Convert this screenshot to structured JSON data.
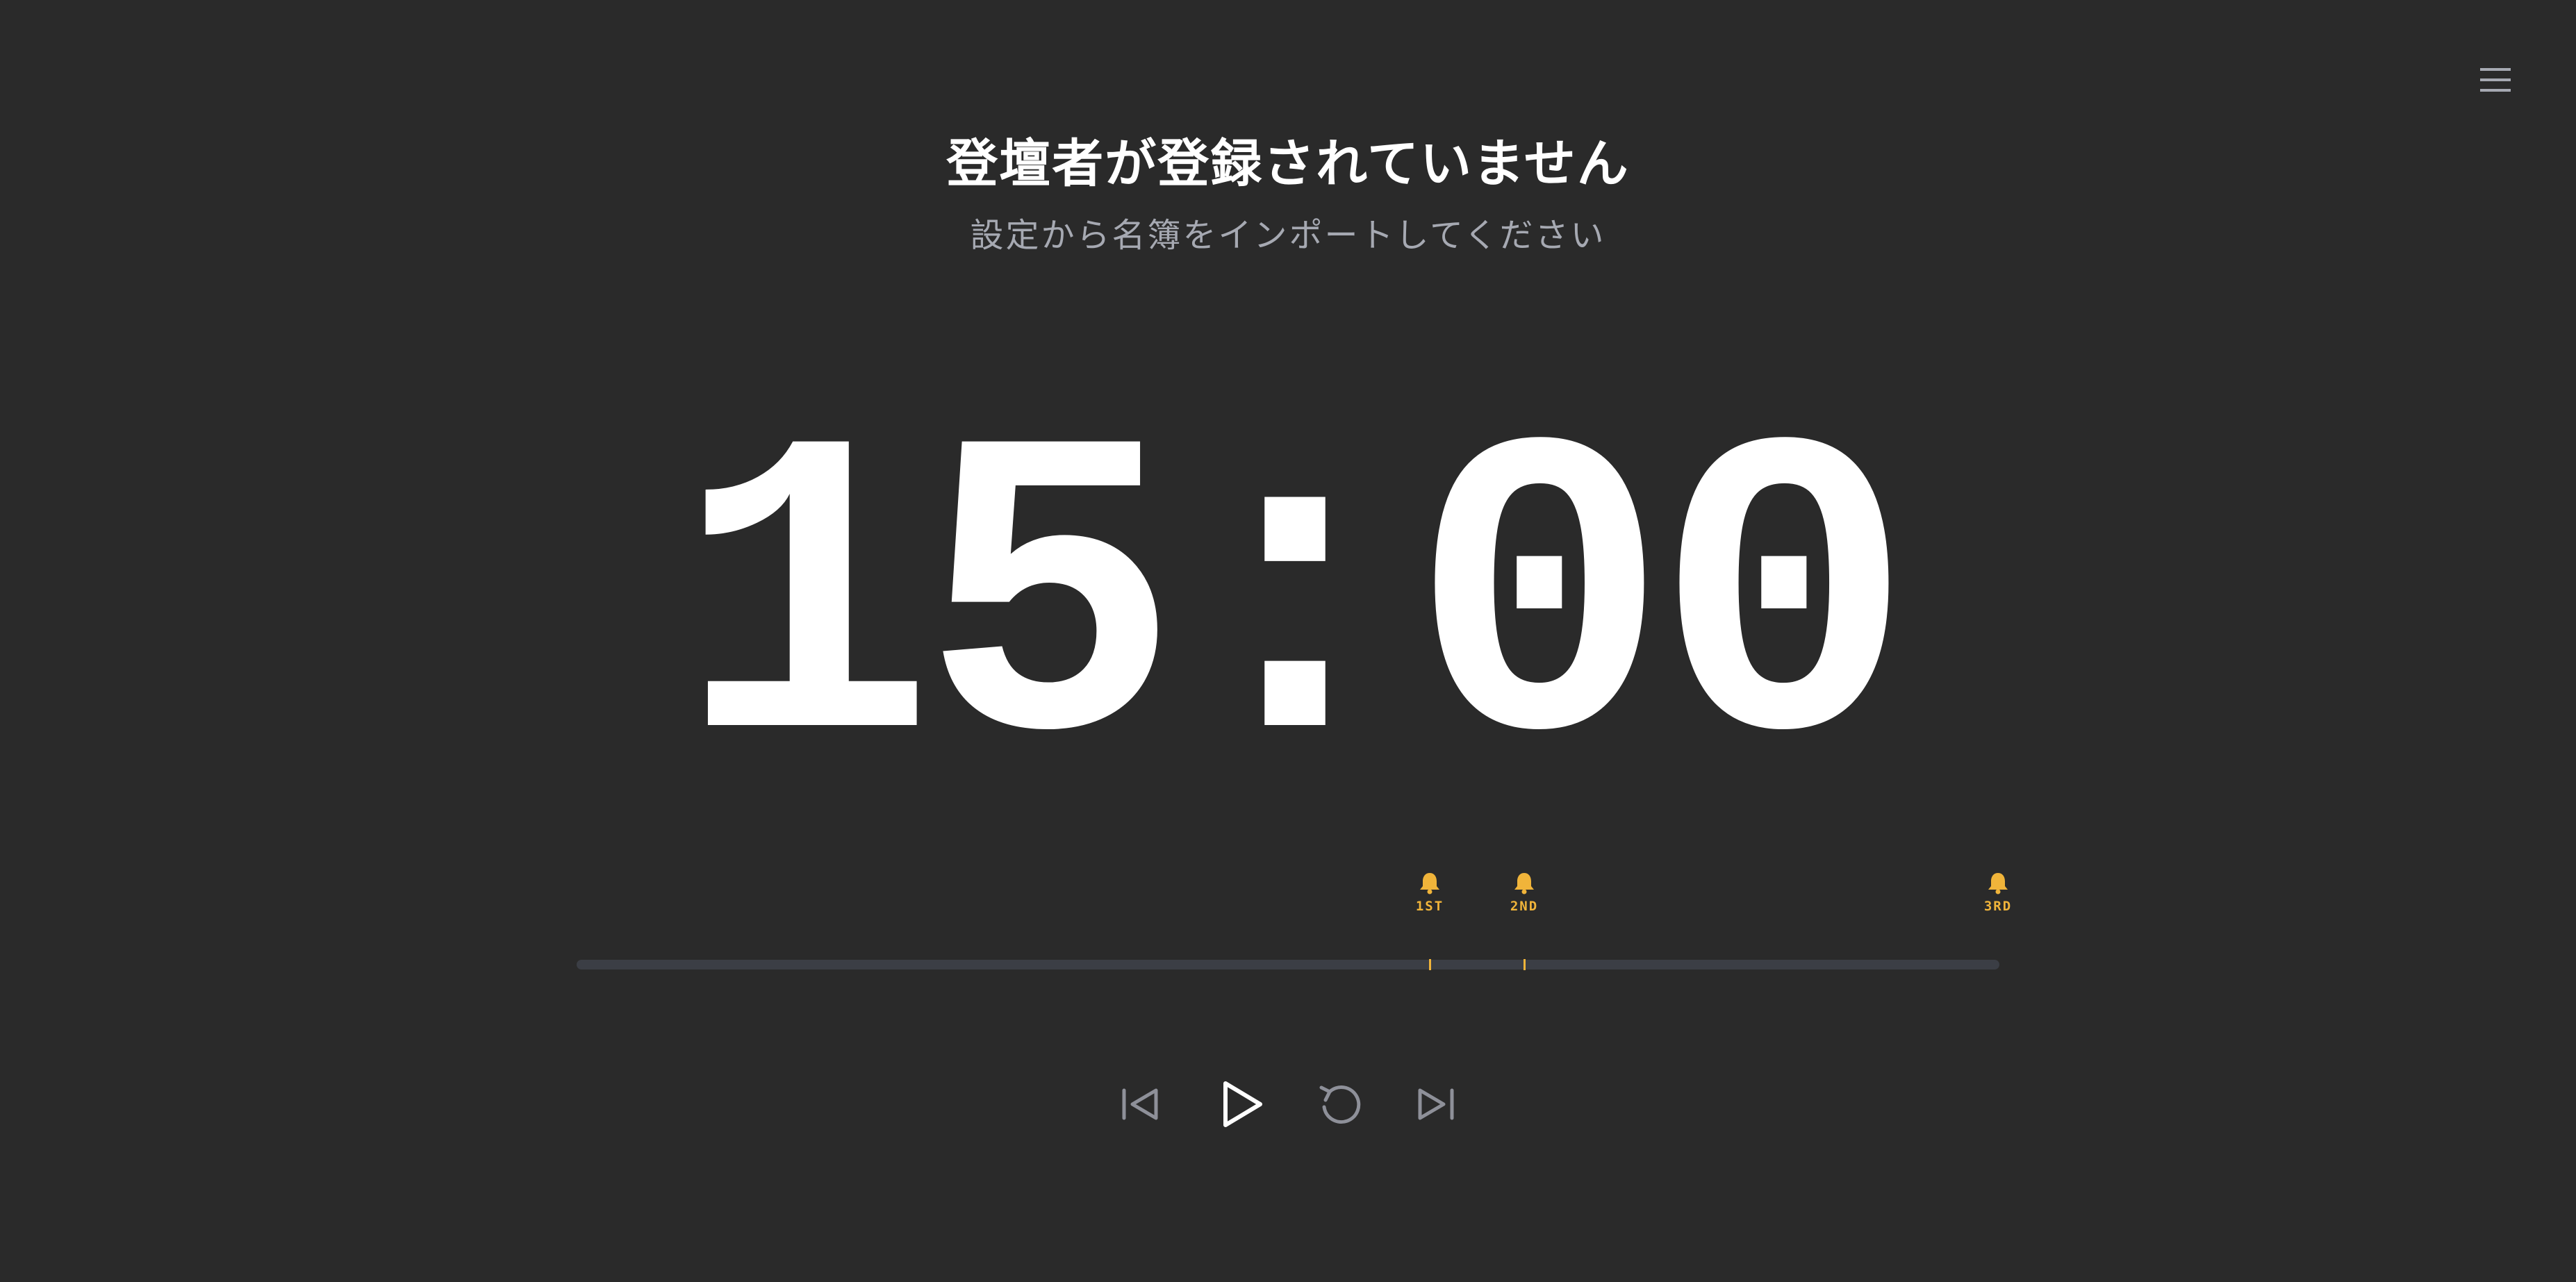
{
  "header": {
    "title": "登壇者が登録されていません",
    "subtitle": "設定から名簿をインポートしてください"
  },
  "timer": {
    "display": "15:00"
  },
  "bells": [
    {
      "label": "1ST",
      "progress": 0.6
    },
    {
      "label": "2ND",
      "progress": 0.667
    },
    {
      "label": "3RD",
      "progress": 1.0
    }
  ],
  "progress": {
    "value": 0
  },
  "icons": {
    "menu": "menu-icon",
    "bell": "bell-icon",
    "previous": "skip-previous-icon",
    "play": "play-icon",
    "reset": "reset-icon",
    "next": "skip-next-icon"
  },
  "colors": {
    "background": "#2a2a2a",
    "text": "#ffffff",
    "subtext": "#a6a9b2",
    "accent": "#f0b43a",
    "track": "#3b3e45",
    "control": "#8e9099"
  }
}
